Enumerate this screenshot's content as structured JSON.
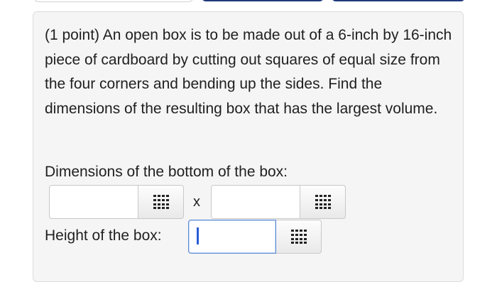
{
  "problem": {
    "text": "(1 point) An open box is to be made out of a 6-inch by 16-inch piece of cardboard by cutting out squares of equal size from the four corners and bending up the sides. Find the dimensions of the resulting box that has the largest volume."
  },
  "answers": {
    "dims_label": "Dimensions of the bottom of the box:",
    "times_sign": "x",
    "height_label": "Height of the box:",
    "dim1_value": "",
    "dim2_value": "",
    "height_value": ""
  },
  "icons": {
    "palette": "grid-keypad-icon"
  },
  "colors": {
    "top_button": "#1e3a7b",
    "card_background": "#f5f5f5",
    "caret": "#2a5bd7"
  }
}
